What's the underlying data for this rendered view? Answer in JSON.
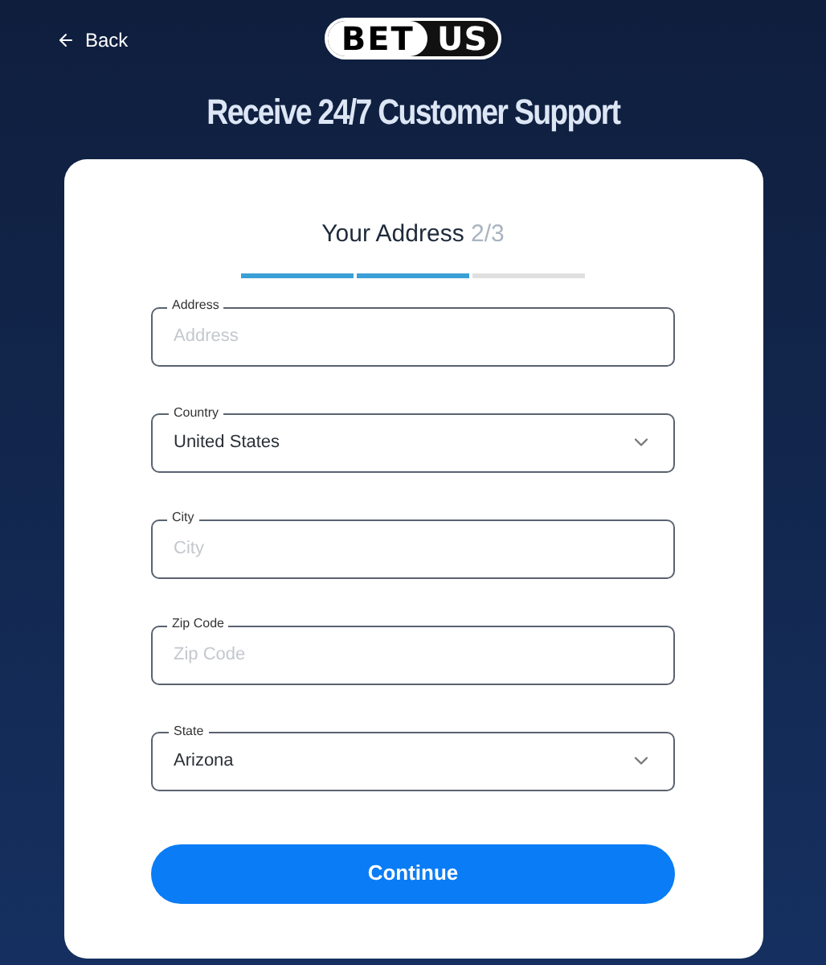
{
  "header": {
    "back": "Back",
    "logo": {
      "left": "BET",
      "right": "US"
    }
  },
  "title": "Receive 24/7 Customer Support",
  "form": {
    "heading": "Your Address",
    "step": "2/3",
    "progress": [
      {
        "done": true
      },
      {
        "done": true
      },
      {
        "done": false
      }
    ],
    "fields": [
      {
        "kind": "text",
        "label": "Address",
        "placeholder": "Address"
      },
      {
        "kind": "select",
        "label": "Country",
        "value": "United States"
      },
      {
        "kind": "text",
        "label": "City",
        "placeholder": "City"
      },
      {
        "kind": "text",
        "label": "Zip Code",
        "placeholder": "Zip Code"
      },
      {
        "kind": "select",
        "label": "State",
        "value": "Arizona"
      }
    ],
    "button": "Continue"
  }
}
